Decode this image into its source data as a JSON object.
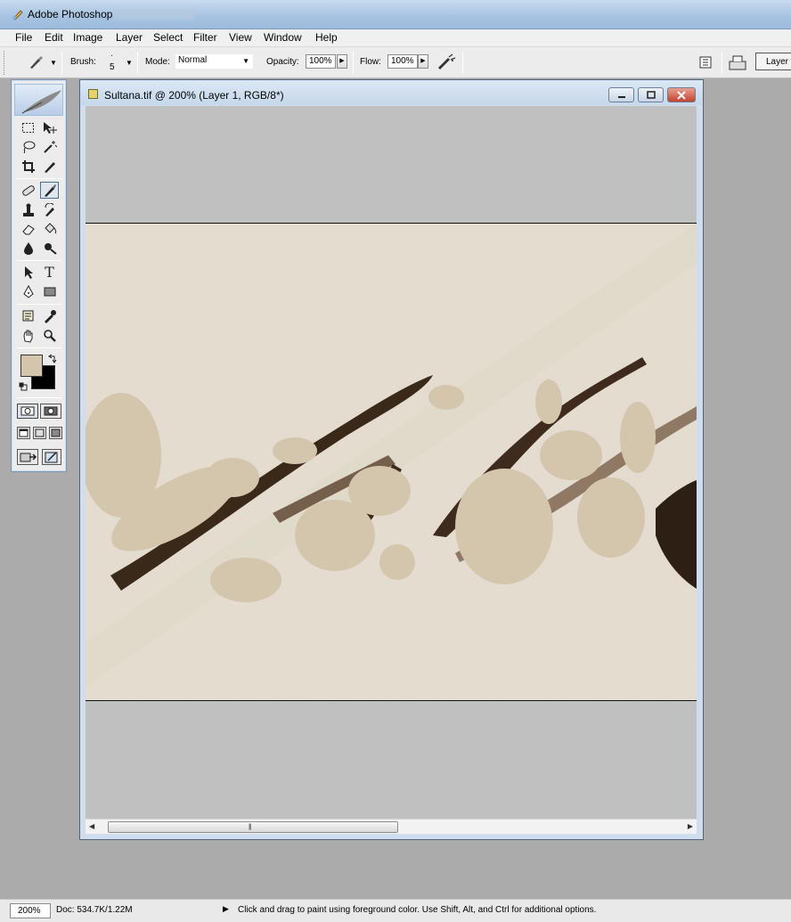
{
  "app": {
    "title": "Adobe Photoshop"
  },
  "menu": [
    "File",
    "Edit",
    "Image",
    "Layer",
    "Select",
    "Filter",
    "View",
    "Window",
    "Help"
  ],
  "options": {
    "brush_label": "Brush:",
    "brush_size": "5",
    "mode_label": "Mode:",
    "mode_value": "Normal",
    "opacity_label": "Opacity:",
    "opacity_value": "100%",
    "flow_label": "Flow:",
    "flow_value": "100%",
    "layer_button": "Layer"
  },
  "toolbox": {
    "foreground_color": "#d4c6ad",
    "background_color": "#000000",
    "tools": [
      "marquee-tool",
      "move-tool",
      "lasso-tool",
      "magic-wand-tool",
      "crop-tool",
      "slice-tool",
      "healing-brush-tool",
      "brush-tool",
      "clone-stamp-tool",
      "history-brush-tool",
      "eraser-tool",
      "paint-bucket-tool",
      "blur-tool",
      "dodge-tool",
      "path-selection-tool",
      "type-tool",
      "pen-tool",
      "rectangle-tool",
      "notes-tool",
      "eyedropper-tool",
      "hand-tool",
      "zoom-tool"
    ],
    "active_tool": "brush-tool"
  },
  "document": {
    "title": "Sultana.tif @ 200% (Layer 1, RGB/8*)",
    "scroll_position": 0.0
  },
  "status": {
    "zoom": "200%",
    "doc_info": "Doc: 534.7K/1.22M",
    "hint": "Click and drag to paint using foreground color.  Use Shift, Alt, and Ctrl for additional options."
  }
}
